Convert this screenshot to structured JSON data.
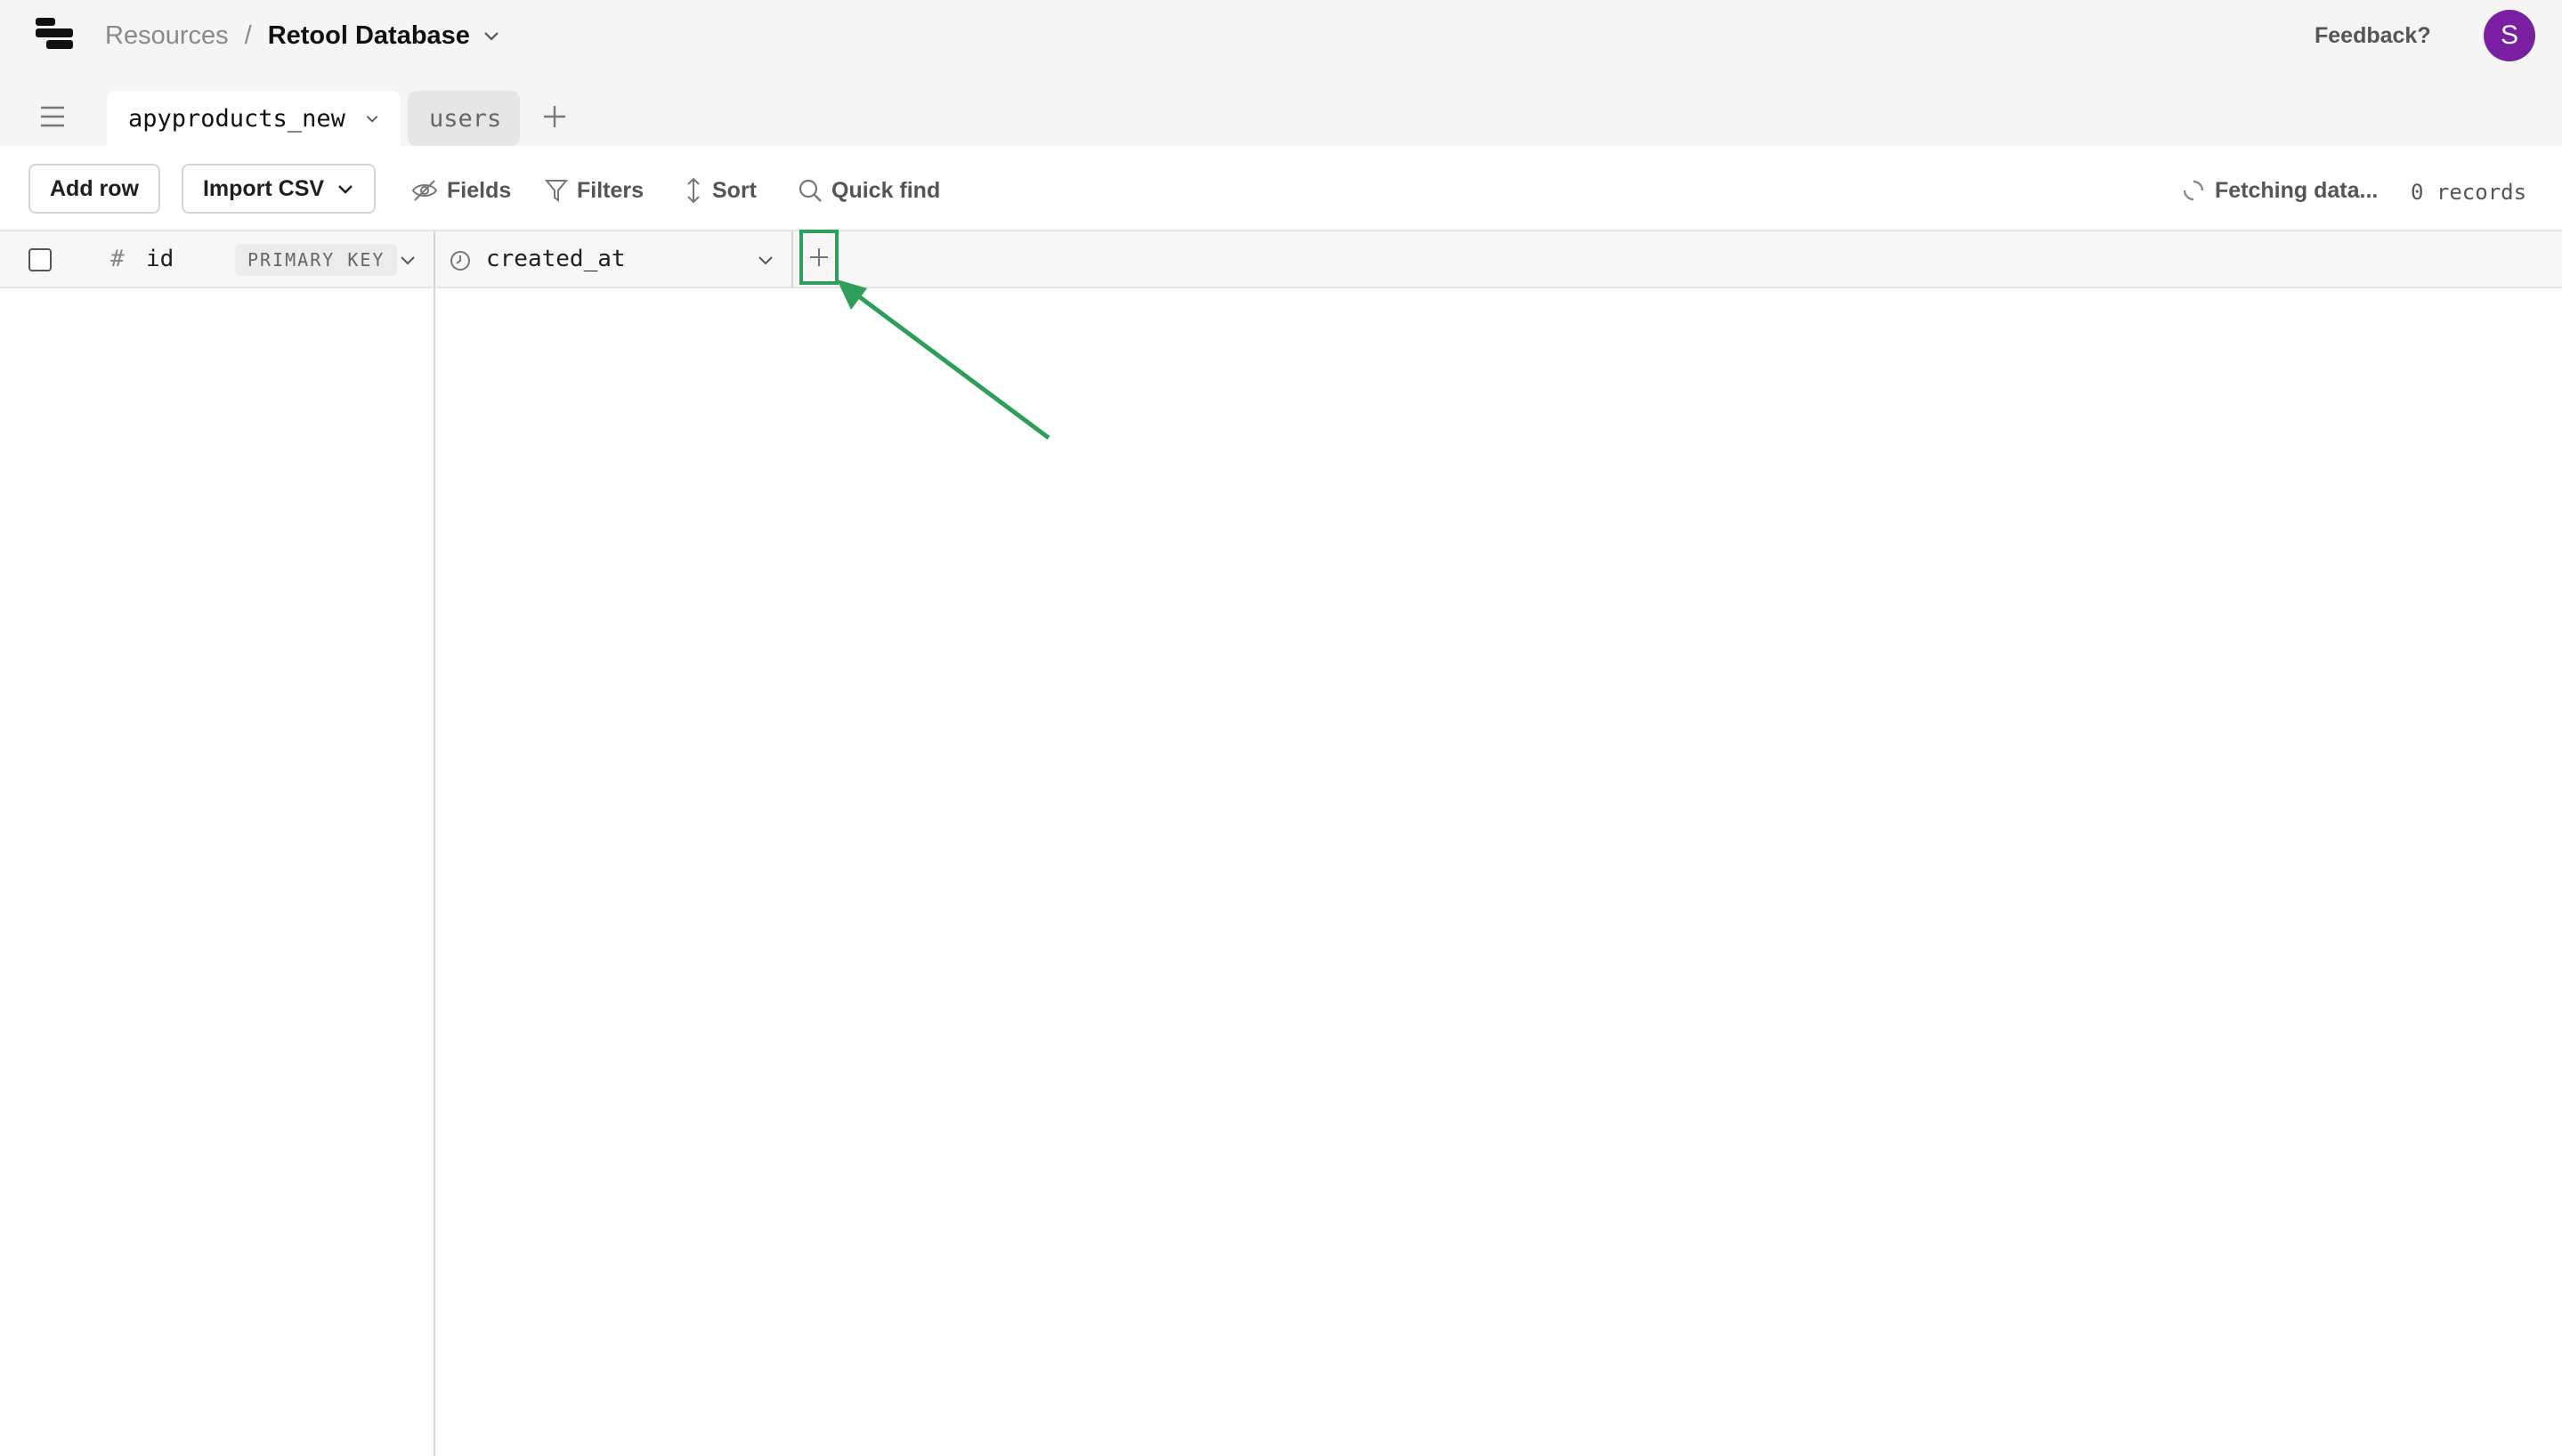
{
  "breadcrumb": {
    "parent": "Resources",
    "separator": "/",
    "current": "Retool Database"
  },
  "header": {
    "feedback_label": "Feedback?",
    "avatar_initial": "S",
    "avatar_color": "#7b1fa2"
  },
  "tabs": [
    {
      "label": "apyproducts_new",
      "active": true
    },
    {
      "label": "users",
      "active": false
    }
  ],
  "toolbar": {
    "add_row_label": "Add row",
    "import_csv_label": "Import CSV",
    "fields_label": "Fields",
    "filters_label": "Filters",
    "sort_label": "Sort",
    "quick_find_label": "Quick find",
    "status_label": "Fetching data...",
    "records_label": "0 records"
  },
  "columns": [
    {
      "icon": "hash-icon",
      "name": "id",
      "badge": "PRIMARY KEY"
    },
    {
      "icon": "clock-icon",
      "name": "created_at"
    }
  ],
  "colors": {
    "highlight": "#2e9e5b",
    "avatar": "#7b1fa2"
  }
}
